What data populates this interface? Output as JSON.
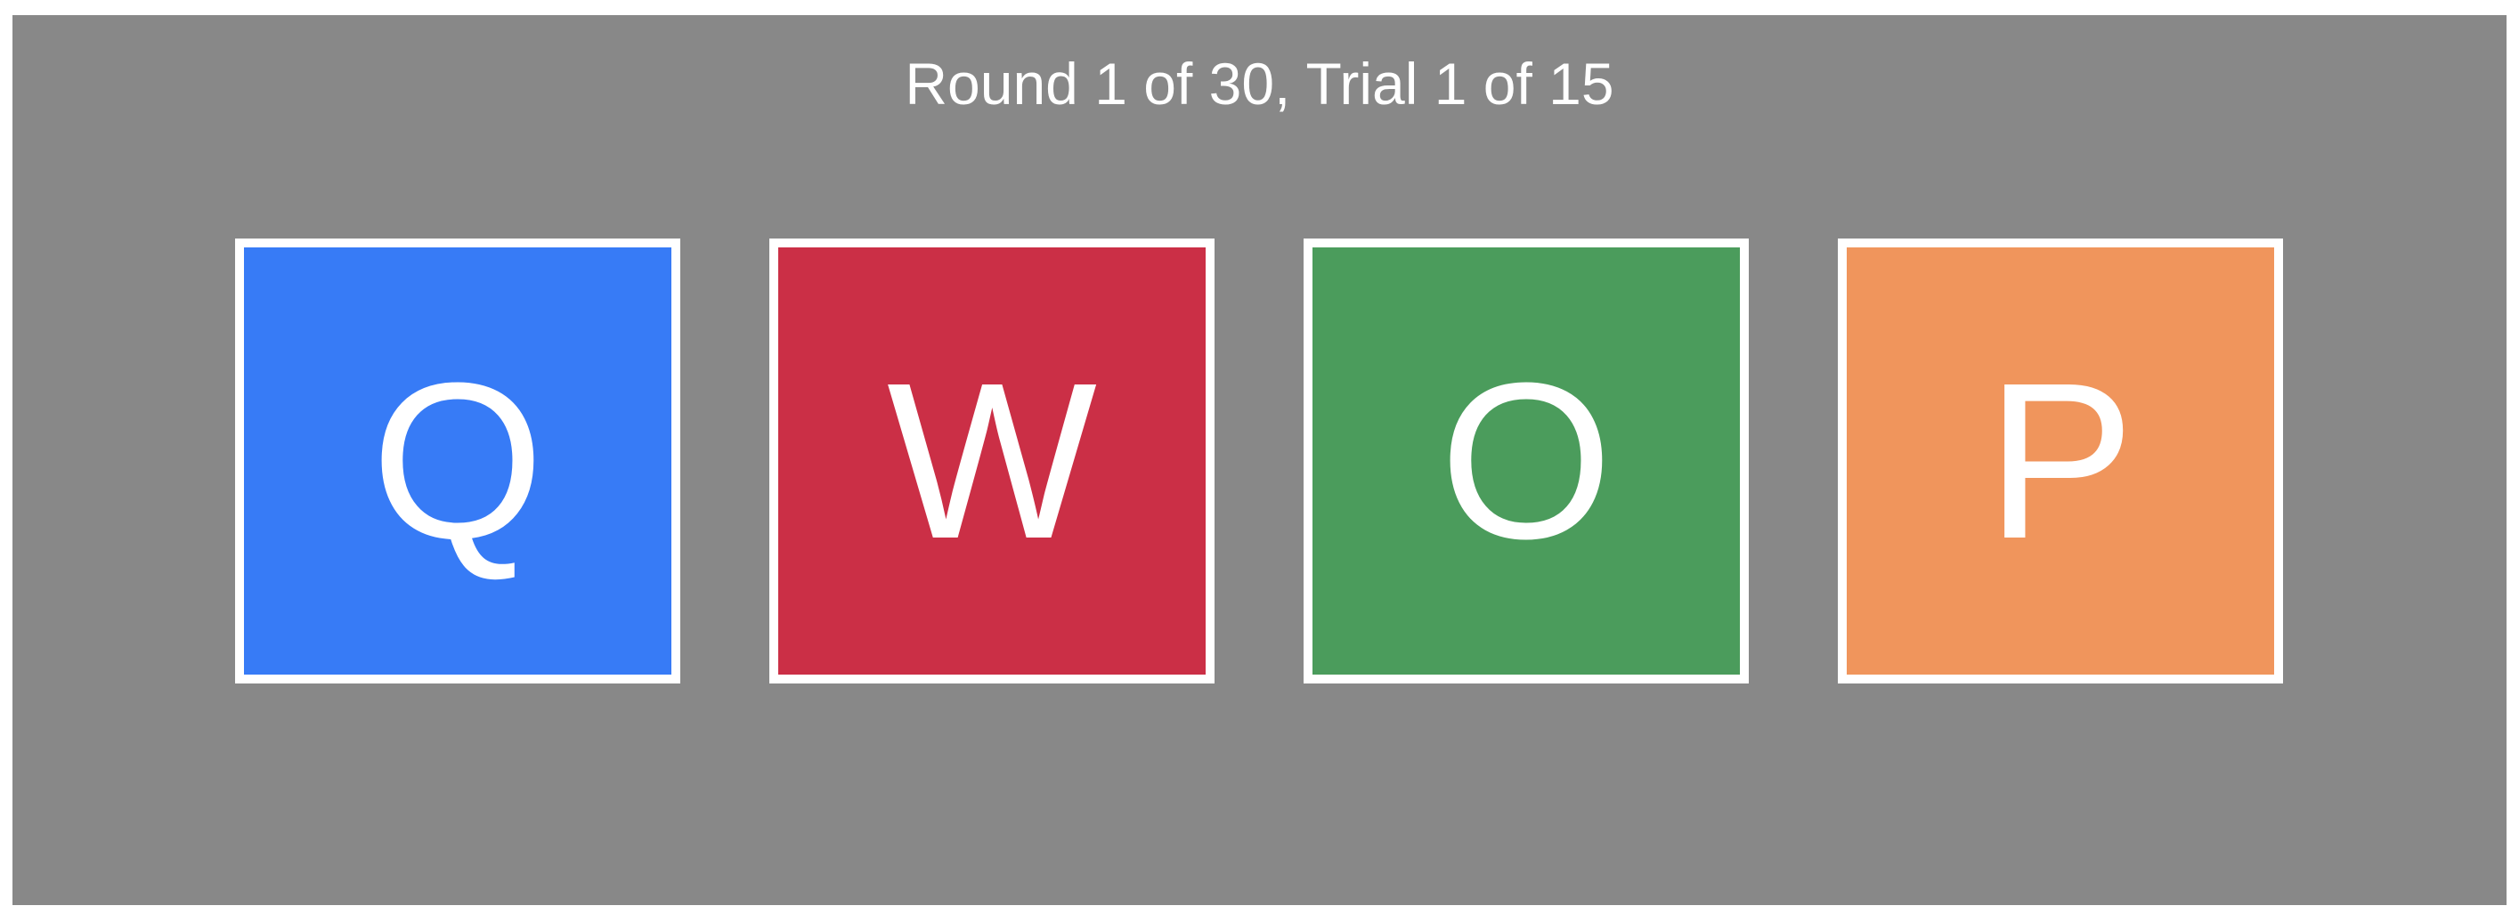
{
  "status": {
    "text": "Round 1 of 30, Trial 1 of 15"
  },
  "tiles": [
    {
      "letter": "Q",
      "color": "#377BF6"
    },
    {
      "letter": "W",
      "color": "#CB2F46"
    },
    {
      "letter": "O",
      "color": "#4B9C5C"
    },
    {
      "letter": "P",
      "color": "#F0955C"
    }
  ],
  "theme": {
    "background": "#888888",
    "border": "#FFFFFF",
    "text": "#FFFFFF"
  }
}
